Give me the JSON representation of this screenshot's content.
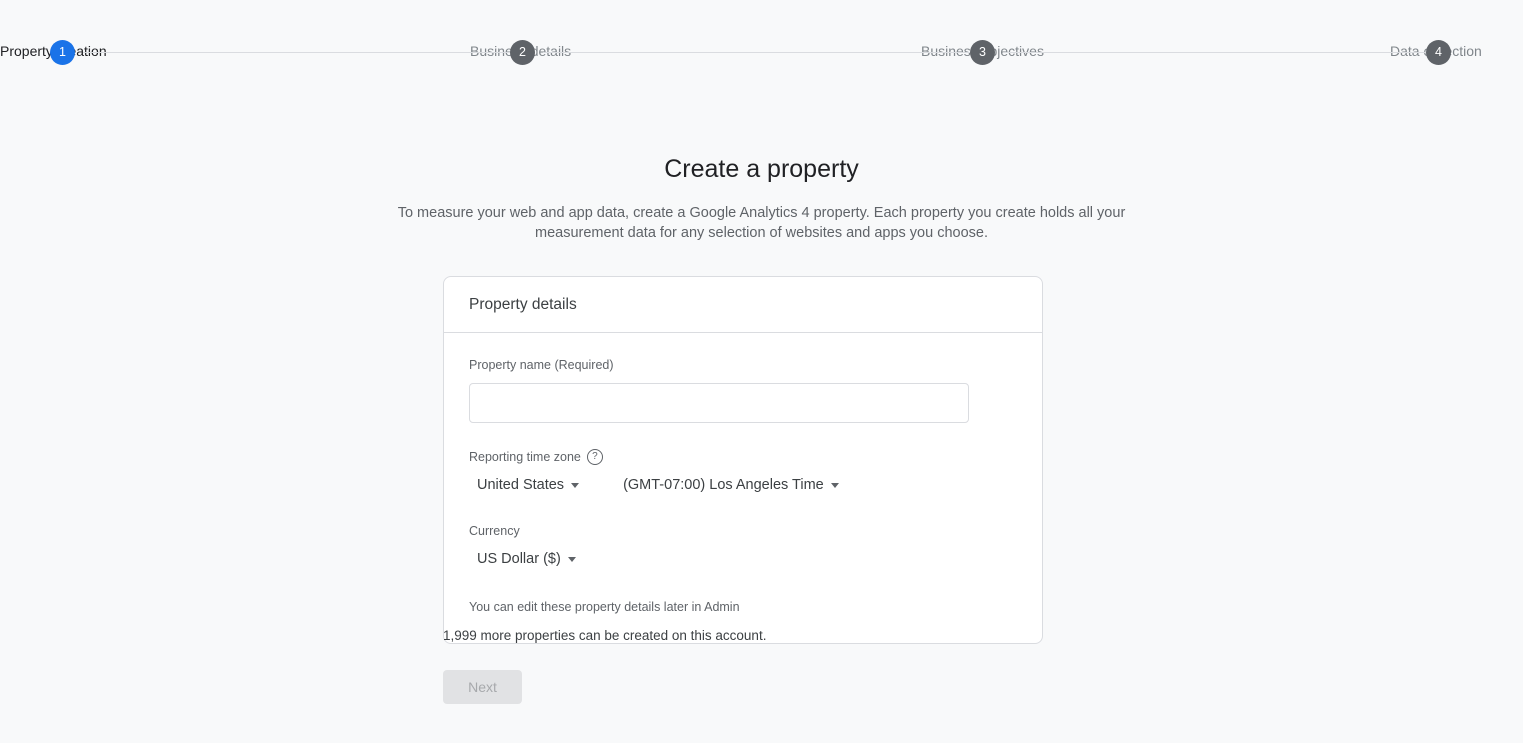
{
  "stepper": {
    "steps": [
      {
        "number": "1",
        "label": "Property creation",
        "state": "active"
      },
      {
        "number": "2",
        "label": "Business details",
        "state": "inactive"
      },
      {
        "number": "3",
        "label": "Business objectives",
        "state": "inactive"
      },
      {
        "number": "4",
        "label": "Data collection",
        "state": "inactive"
      }
    ],
    "active_color": "#1a73e8",
    "inactive_color": "#5f6368",
    "connector_color": "#dadce0"
  },
  "page": {
    "title": "Create a property",
    "description": "To measure your web and app data, create a Google Analytics 4 property. Each property you create holds all your measurement data for any selection of websites and apps you choose."
  },
  "card": {
    "header": "Property details",
    "property_name": {
      "label": "Property name (Required)",
      "value": "",
      "placeholder": ""
    },
    "time_zone": {
      "label": "Reporting time zone",
      "help_icon": "help-circle-icon",
      "country_value": "United States",
      "zone_value": "(GMT-07:00) Los Angeles Time",
      "caret_icon": "chevron-down-icon"
    },
    "currency": {
      "label": "Currency",
      "value": "US Dollar ($)",
      "caret_icon": "chevron-down-icon"
    },
    "note": "You can edit these property details later in Admin"
  },
  "footer": {
    "quota_text": "1,999 more properties can be created on this account.",
    "next_label": "Next",
    "next_disabled": true
  }
}
